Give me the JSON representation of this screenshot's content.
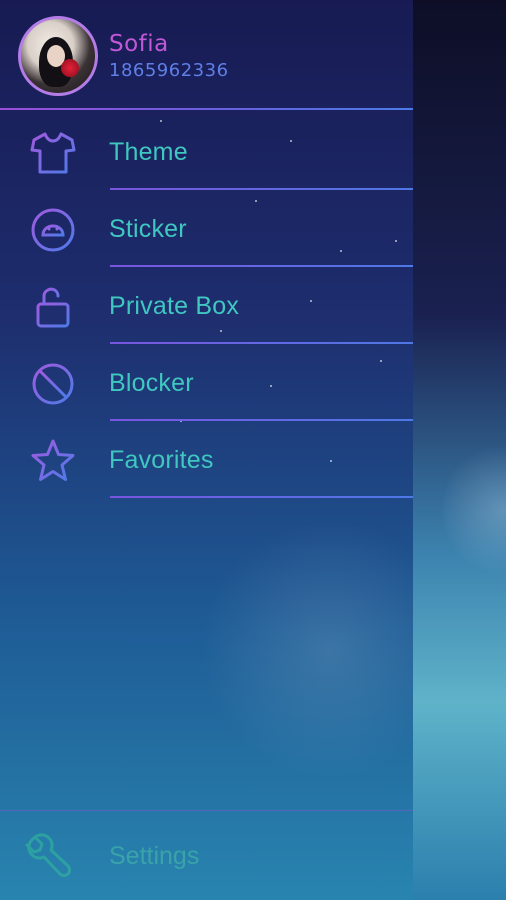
{
  "user": {
    "name": "Sofia",
    "phone": "1865962336"
  },
  "menu": {
    "items": [
      {
        "label": "Theme",
        "icon": "tshirt-icon"
      },
      {
        "label": "Sticker",
        "icon": "sticker-icon"
      },
      {
        "label": "Private Box",
        "icon": "lock-open-icon"
      },
      {
        "label": "Blocker",
        "icon": "block-icon"
      },
      {
        "label": "Favorites",
        "icon": "star-icon"
      }
    ]
  },
  "footer": {
    "settings_label": "Settings",
    "settings_icon": "wrench-icon"
  },
  "colors": {
    "accent_purple": "#c058d8",
    "accent_blue": "#5f7fe6",
    "menu_text": "#3fc7c0"
  }
}
